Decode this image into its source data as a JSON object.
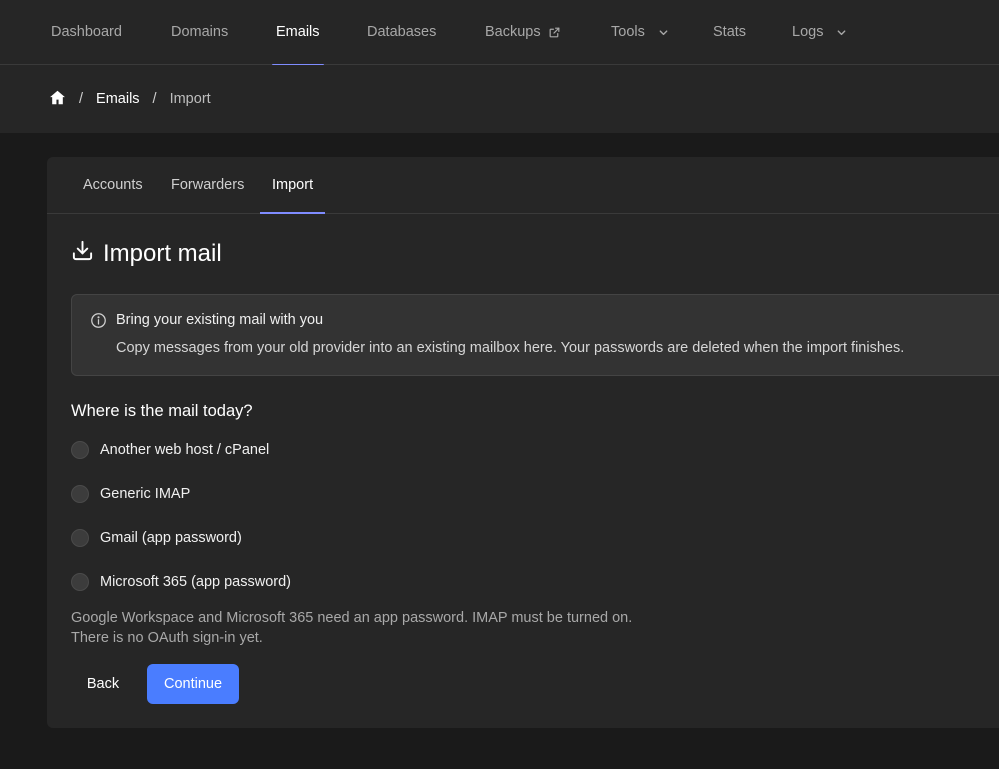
{
  "topnav": {
    "items": [
      {
        "label": "Dashboard",
        "active": false
      },
      {
        "label": "Domains",
        "active": false
      },
      {
        "label": "Emails",
        "active": true
      },
      {
        "label": "Databases",
        "active": false
      },
      {
        "label": "Backups",
        "active": false,
        "icon": "external-link-icon"
      },
      {
        "label": "Tools",
        "active": false,
        "icon": "chevron-down-icon"
      },
      {
        "label": "Stats",
        "active": false
      },
      {
        "label": "Logs",
        "active": false,
        "icon": "chevron-down-icon"
      }
    ],
    "accent": "#7f8cff"
  },
  "breadcrumb": {
    "home_icon": "home-icon",
    "separator": "/",
    "items": [
      {
        "label": "Emails"
      },
      {
        "label": "Import"
      }
    ]
  },
  "tabs": [
    {
      "label": "Accounts",
      "active": false
    },
    {
      "label": "Forwarders",
      "active": false
    },
    {
      "label": "Import",
      "active": true
    }
  ],
  "page": {
    "title": "Import mail",
    "title_icon": "download-icon"
  },
  "notice": {
    "icon": "info-icon",
    "title": "Bring your existing mail with you",
    "body": "Copy messages from your old provider into an existing mailbox here. Your passwords are deleted when the import finishes."
  },
  "form": {
    "question": "Where is the mail today?",
    "options": [
      {
        "label": "Another web host / cPanel",
        "selected": false
      },
      {
        "label": "Generic IMAP",
        "selected": false
      },
      {
        "label": "Gmail (app password)",
        "selected": false
      },
      {
        "label": "Microsoft 365 (app password)",
        "selected": false
      }
    ],
    "help": "Google Workspace and Microsoft 365 need an app password. IMAP must be turned on. There is no OAuth sign-in yet.",
    "back_label": "Back",
    "continue_label": "Continue",
    "primary_color": "#4a7dff"
  }
}
